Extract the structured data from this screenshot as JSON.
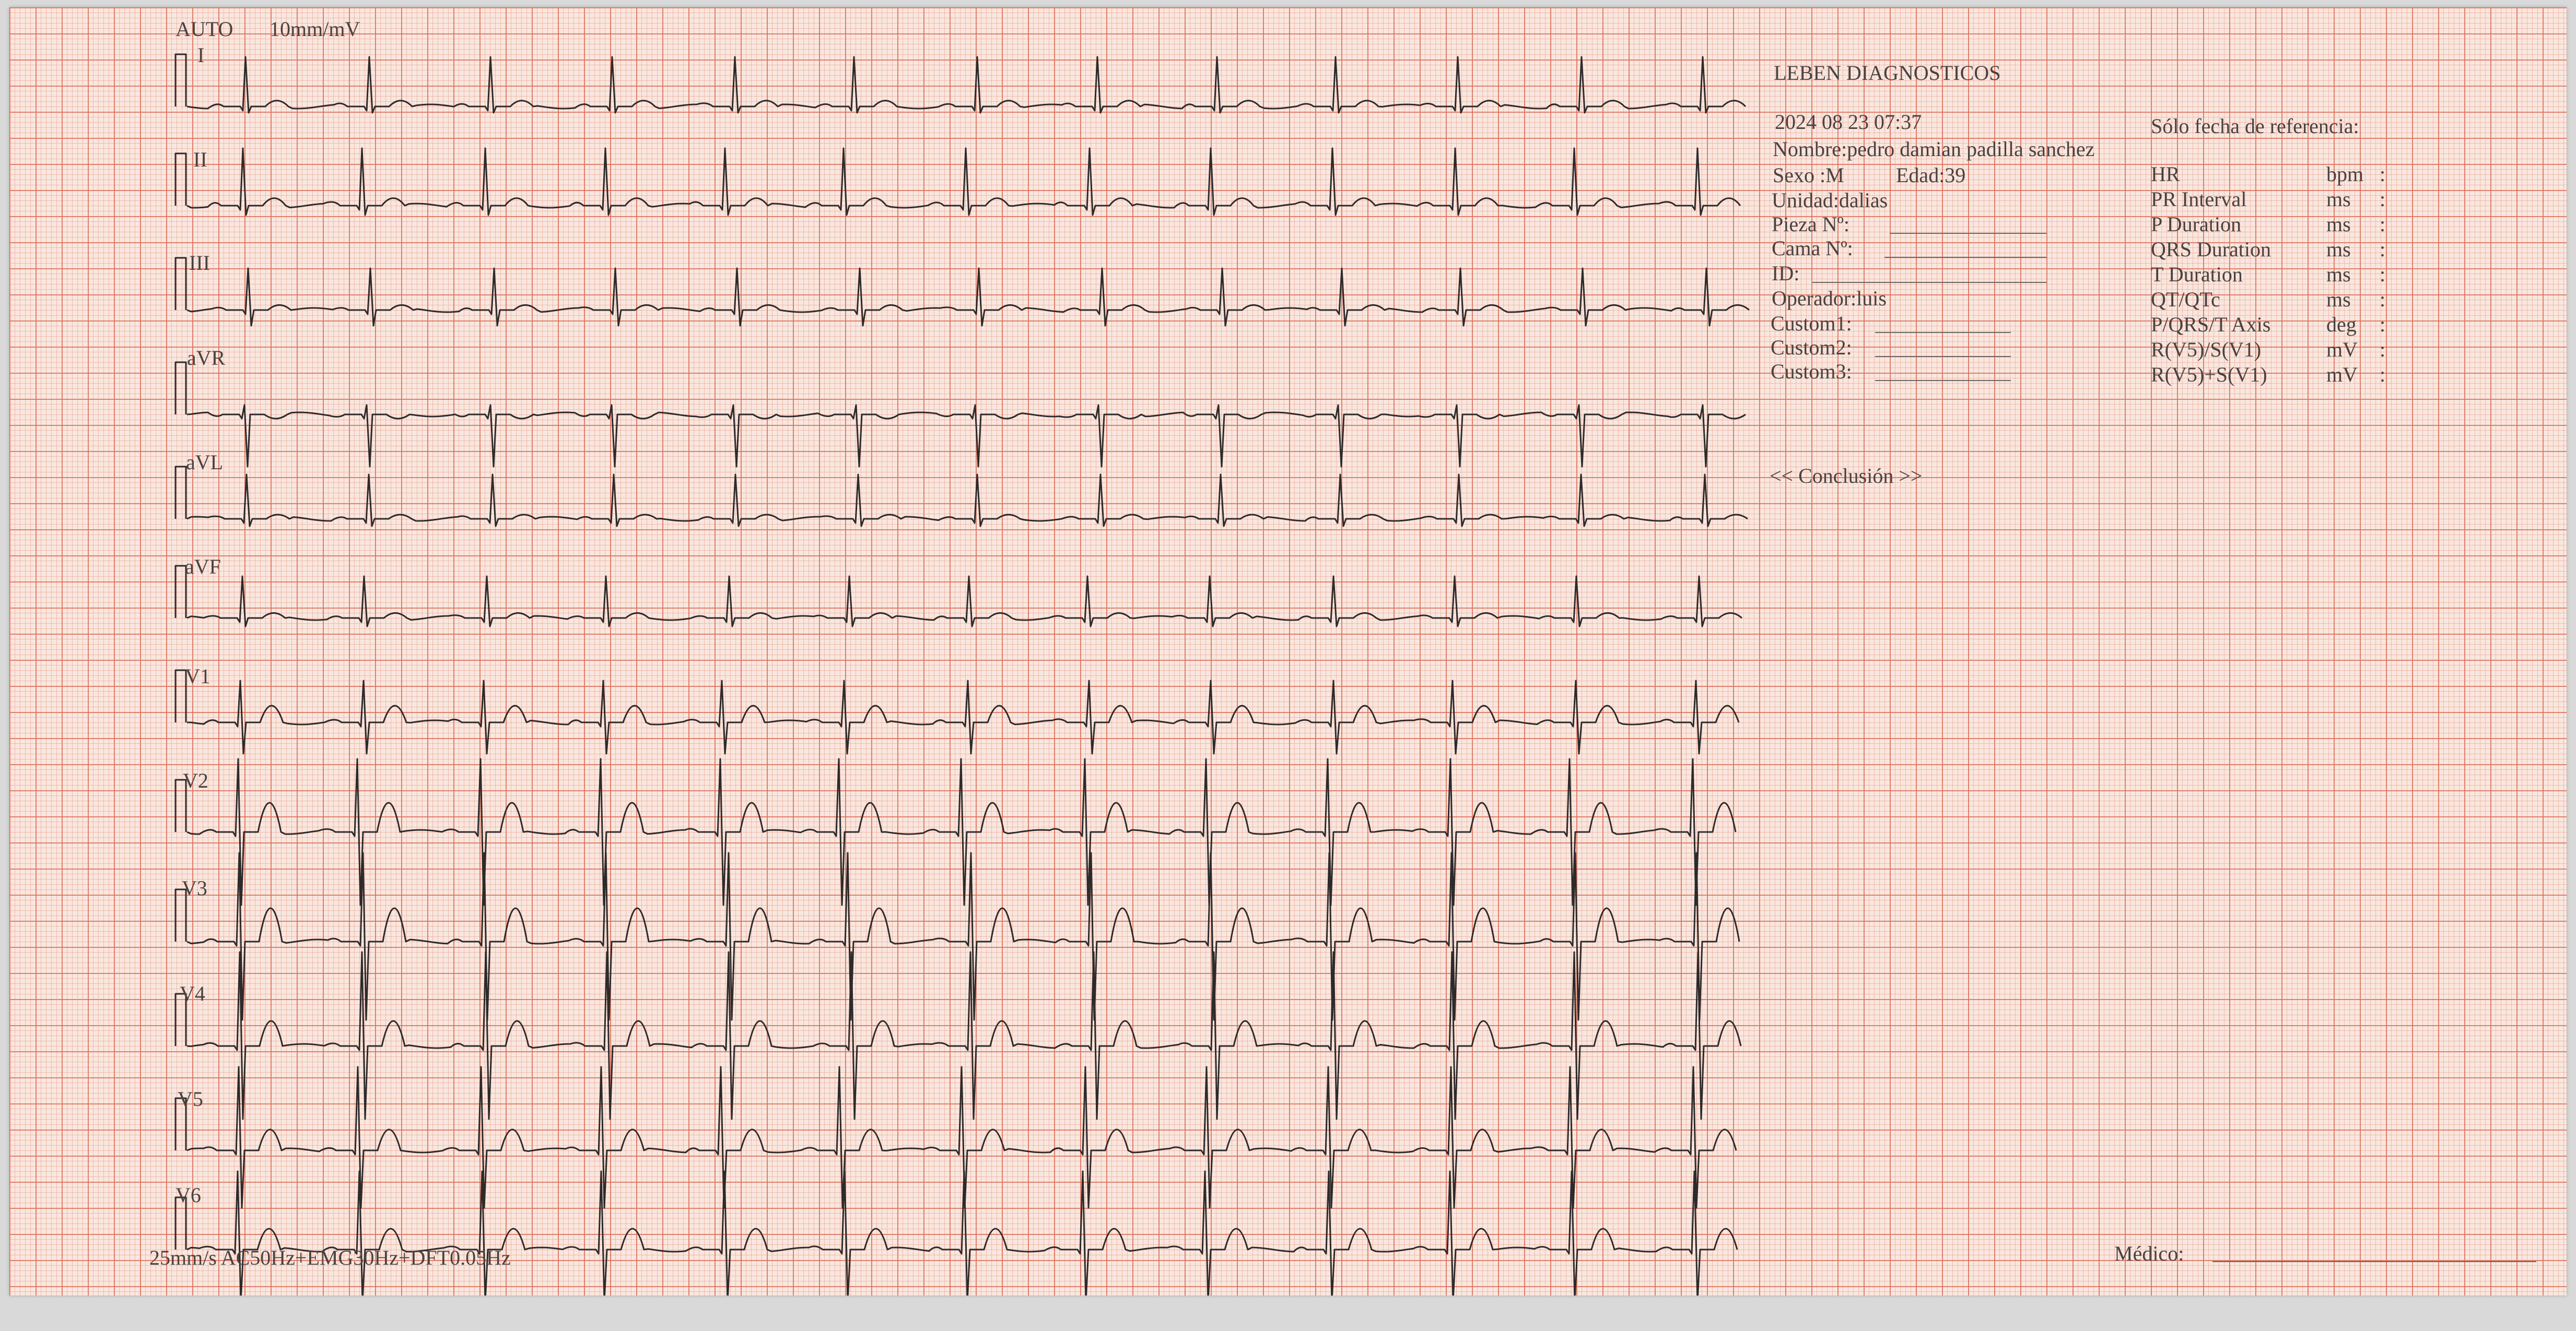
{
  "ecg": {
    "mode_label": "AUTO",
    "gain": "10mm/mV",
    "speed_filters": "25mm/s  AC50Hz+EMG30Hz+DFT0.05Hz",
    "leads": [
      "I",
      "II",
      "III",
      "aVR",
      "aVL",
      "aVF",
      "V1",
      "V2",
      "V3",
      "V4",
      "V5",
      "V6"
    ],
    "trace_color": "#2e2a2a",
    "grid_color": "#de705c"
  },
  "header": {
    "institution": "LEBEN DIAGNOSTICOS",
    "datetime": "2024 08 23 07:37",
    "reference_note": "Sólo fecha de referencia:",
    "name": "Nombre:pedro damian padilla sanchez",
    "sex": "Sexo :M",
    "age": "Edad:39",
    "unit": "Unidad:dalias",
    "room": "Pieza Nº:",
    "bed": "Cama Nº:",
    "id": "ID:",
    "operator": "Operador:luis",
    "custom1": "Custom1:",
    "custom2": "Custom2:",
    "custom3": "Custom3:"
  },
  "measurements": [
    {
      "label": "HR",
      "unit": "bpm",
      "value": ":"
    },
    {
      "label": "PR Interval",
      "unit": "ms",
      "value": ":"
    },
    {
      "label": "P Duration",
      "unit": "ms",
      "value": ":"
    },
    {
      "label": "QRS Duration",
      "unit": "ms",
      "value": ":"
    },
    {
      "label": "T Duration",
      "unit": "ms",
      "value": ":"
    },
    {
      "label": "QT/QTc",
      "unit": "ms",
      "value": ":"
    },
    {
      "label": "P/QRS/T Axis",
      "unit": "deg",
      "value": ":"
    },
    {
      "label": "R(V5)/S(V1)",
      "unit": "mV",
      "value": ":"
    },
    {
      "label": "R(V5)+S(V1)",
      "unit": "mV",
      "value": ":"
    }
  ],
  "conclusion_label": "<< Conclusión >>",
  "physician_label": "Médico:"
}
